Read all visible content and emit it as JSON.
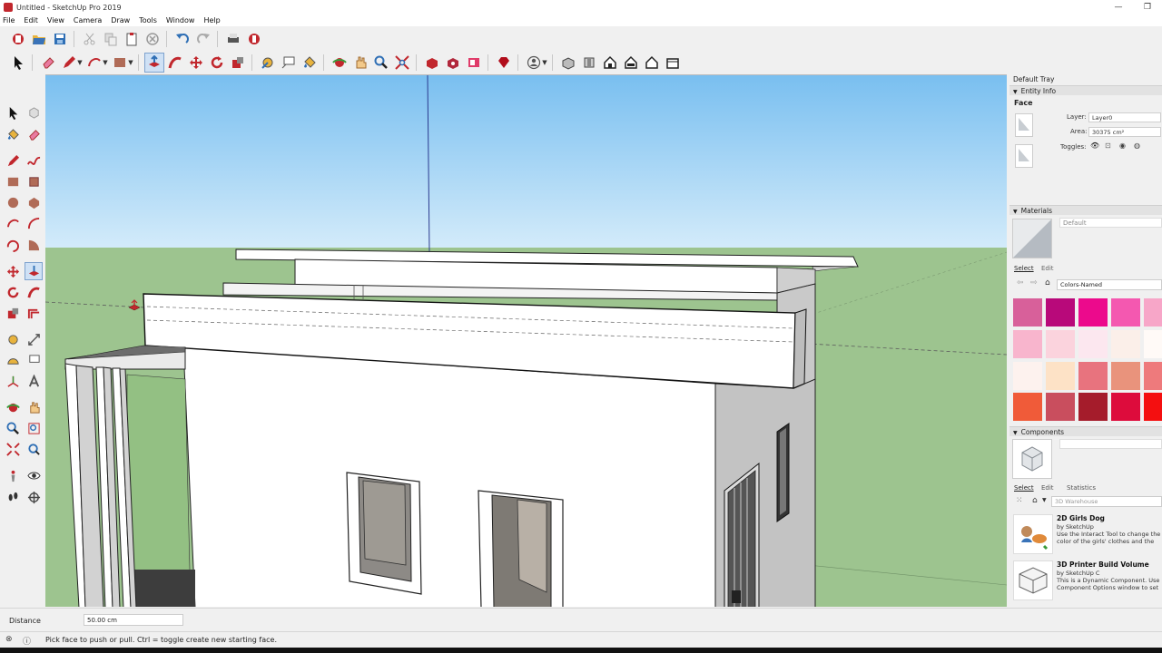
{
  "window": {
    "title": "Untitled - SketchUp Pro 2019",
    "minimize": "—",
    "restore": "❐"
  },
  "menu": [
    "File",
    "Edit",
    "View",
    "Camera",
    "Draw",
    "Tools",
    "Window",
    "Help"
  ],
  "tray": {
    "title": "Default Tray",
    "entity_info": {
      "header": "Entity Info",
      "type": "Face",
      "layer_label": "Layer:",
      "layer_value": "Layer0",
      "area_label": "Area:",
      "area_value": "30375 cm²",
      "toggles_label": "Toggles:"
    },
    "materials": {
      "header": "Materials",
      "current": "Default",
      "tab_select": "Select",
      "tab_edit": "Edit",
      "library": "Colors-Named",
      "swatches": [
        "#d8609a",
        "#b8097a",
        "#ec0a8c",
        "#f458b0",
        "#f7a6c8",
        "#f8b5cd",
        "#fbd3dd",
        "#fce7ef",
        "#fbefe9",
        "#fffaf7",
        "#fdf2ee",
        "#fde2c6",
        "#e8737e",
        "#e9937c",
        "#ee7a7c",
        "#f05b39",
        "#c94e5e",
        "#a51c2b",
        "#dd0c3c",
        "#f40f10"
      ]
    },
    "components": {
      "header": "Components",
      "tab_select": "Select",
      "tab_edit": "Edit",
      "tab_statistics": "Statistics",
      "search_placeholder": "3D Warehouse",
      "items": [
        {
          "name": "2D Girls Dog",
          "by": "by SketchUp",
          "desc": "Use the Interact Tool to change the color of the girls' clothes and the dog"
        },
        {
          "name": "3D Printer Build Volume",
          "by": "by SketchUp C",
          "desc": "This is a Dynamic Component. Use Component Options window to set the"
        }
      ]
    }
  },
  "measurements": {
    "label": "Distance",
    "value": "50.00 cm"
  },
  "status": {
    "text": "Pick face to push or pull.  Ctrl = toggle create new starting face."
  },
  "colors": {
    "sky_top": "#79bff0",
    "sky_bottom": "#cfe8f8",
    "ground": "#9dc48f",
    "accent": "#c1272d"
  }
}
